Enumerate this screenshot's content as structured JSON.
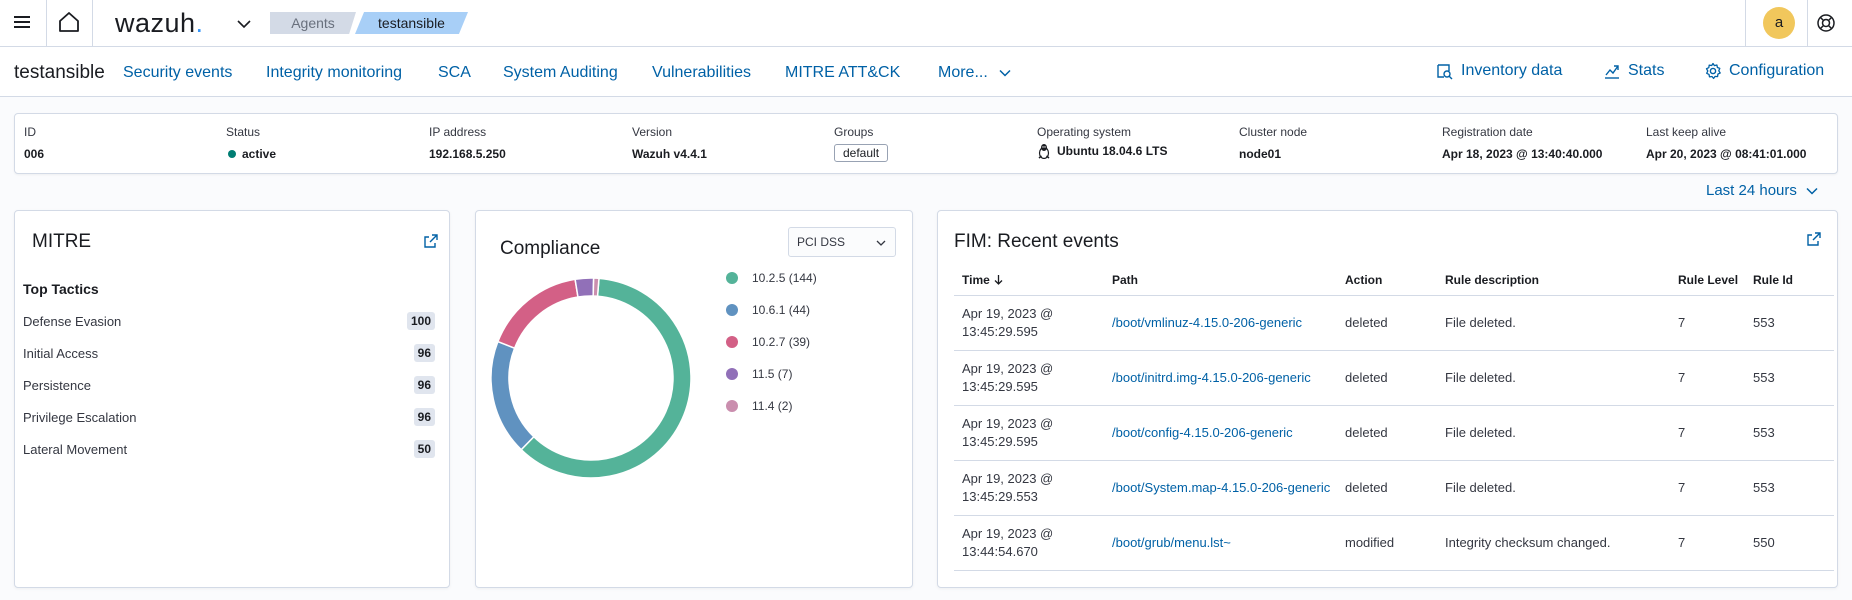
{
  "header": {
    "logo_text": "wazuh",
    "logo_dot": ".",
    "breadcrumbs": [
      "Agents",
      "testansible"
    ],
    "avatar_letter": "a"
  },
  "nav": {
    "agent_name": "testansible",
    "tabs": [
      "Security events",
      "Integrity monitoring",
      "SCA",
      "System Auditing",
      "Vulnerabilities",
      "MITRE ATT&CK",
      "More..."
    ],
    "right_links": [
      "Inventory data",
      "Stats",
      "Configuration"
    ]
  },
  "agent_info": {
    "fields": [
      {
        "label": "ID",
        "value": "006"
      },
      {
        "label": "Status",
        "value": "active"
      },
      {
        "label": "IP address",
        "value": "192.168.5.250"
      },
      {
        "label": "Version",
        "value": "Wazuh v4.4.1"
      },
      {
        "label": "Groups",
        "value": "default"
      },
      {
        "label": "Operating system",
        "value": "Ubuntu 18.04.6 LTS"
      },
      {
        "label": "Cluster node",
        "value": "node01"
      },
      {
        "label": "Registration date",
        "value": "Apr 18, 2023 @ 13:40:40.000"
      },
      {
        "label": "Last keep alive",
        "value": "Apr 20, 2023 @ 08:41:01.000"
      }
    ],
    "status_color": "#017d73"
  },
  "time_range": "Last 24 hours",
  "mitre": {
    "title": "MITRE",
    "subtitle": "Top Tactics",
    "tactics": [
      {
        "name": "Defense Evasion",
        "count": "100"
      },
      {
        "name": "Initial Access",
        "count": "96"
      },
      {
        "name": "Persistence",
        "count": "96"
      },
      {
        "name": "Privilege Escalation",
        "count": "96"
      },
      {
        "name": "Lateral Movement",
        "count": "50"
      }
    ]
  },
  "compliance": {
    "title": "Compliance",
    "selected": "PCI DSS",
    "legend_labels": [
      "10.2.5 (144)",
      "10.6.1 (44)",
      "10.2.7 (39)",
      "11.5 (7)",
      "11.4 (2)"
    ]
  },
  "chart_data": {
    "type": "pie",
    "donut": true,
    "categories": [
      "10.2.5",
      "10.6.1",
      "10.2.7",
      "11.5",
      "11.4"
    ],
    "values": [
      144,
      44,
      39,
      7,
      2
    ],
    "colors": [
      "#54b399",
      "#6092c0",
      "#d36086",
      "#9170b8",
      "#ca8eae"
    ],
    "legend": "right"
  },
  "fim": {
    "title": "FIM: Recent events",
    "columns": [
      "Time",
      "Path",
      "Action",
      "Rule description",
      "Rule Level",
      "Rule Id"
    ],
    "rows": [
      {
        "time1": "Apr 19, 2023 @",
        "time2": "13:45:29.595",
        "path": "/boot/vmlinuz-4.15.0-206-generic",
        "action": "deleted",
        "desc": "File deleted.",
        "level": "7",
        "id": "553"
      },
      {
        "time1": "Apr 19, 2023 @",
        "time2": "13:45:29.595",
        "path": "/boot/initrd.img-4.15.0-206-generic",
        "action": "deleted",
        "desc": "File deleted.",
        "level": "7",
        "id": "553"
      },
      {
        "time1": "Apr 19, 2023 @",
        "time2": "13:45:29.595",
        "path": "/boot/config-4.15.0-206-generic",
        "action": "deleted",
        "desc": "File deleted.",
        "level": "7",
        "id": "553"
      },
      {
        "time1": "Apr 19, 2023 @",
        "time2": "13:45:29.553",
        "path": "/boot/System.map-4.15.0-206-generic",
        "action": "deleted",
        "desc": "File deleted.",
        "level": "7",
        "id": "553"
      },
      {
        "time1": "Apr 19, 2023 @",
        "time2": "13:44:54.670",
        "path": "/boot/grub/menu.lst~",
        "action": "modified",
        "desc": "Integrity checksum changed.",
        "level": "7",
        "id": "550"
      }
    ]
  }
}
